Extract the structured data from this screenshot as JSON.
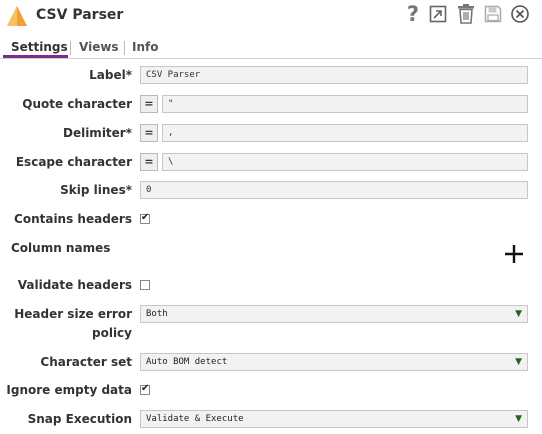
{
  "header": {
    "title": "CSV Parser",
    "icons": [
      "snap-logo-icon",
      "help-icon",
      "expand-icon",
      "trash-icon",
      "save-icon",
      "close-icon"
    ],
    "logo_color": "#f0a030"
  },
  "tabs": [
    {
      "label": "Settings",
      "active": true
    },
    {
      "label": "Views",
      "active": false
    },
    {
      "label": "Info",
      "active": false
    }
  ],
  "accent_color": "#7b2d8e",
  "form": {
    "label": {
      "label": "Label*",
      "value": "CSV Parser"
    },
    "quote_character": {
      "label": "Quote character",
      "eq": "=",
      "value": "\""
    },
    "delimiter": {
      "label": "Delimiter*",
      "eq": "=",
      "value": ","
    },
    "escape_character": {
      "label": "Escape character",
      "eq": "=",
      "value": "\\"
    },
    "skip_lines": {
      "label": "Skip lines*",
      "value": "0"
    },
    "contains_headers": {
      "label": "Contains headers",
      "checked": true
    },
    "column_names": {
      "label": "Column names"
    },
    "validate_headers": {
      "label": "Validate headers",
      "checked": false
    },
    "header_size_error_policy": {
      "label_line1": "Header size error",
      "label_line2": "policy",
      "value": "Both"
    },
    "character_set": {
      "label": "Character set",
      "value": "Auto BOM detect"
    },
    "ignore_empty_data": {
      "label": "Ignore empty data",
      "checked": true
    },
    "snap_execution": {
      "label": "Snap Execution",
      "value": "Validate & Execute"
    }
  }
}
